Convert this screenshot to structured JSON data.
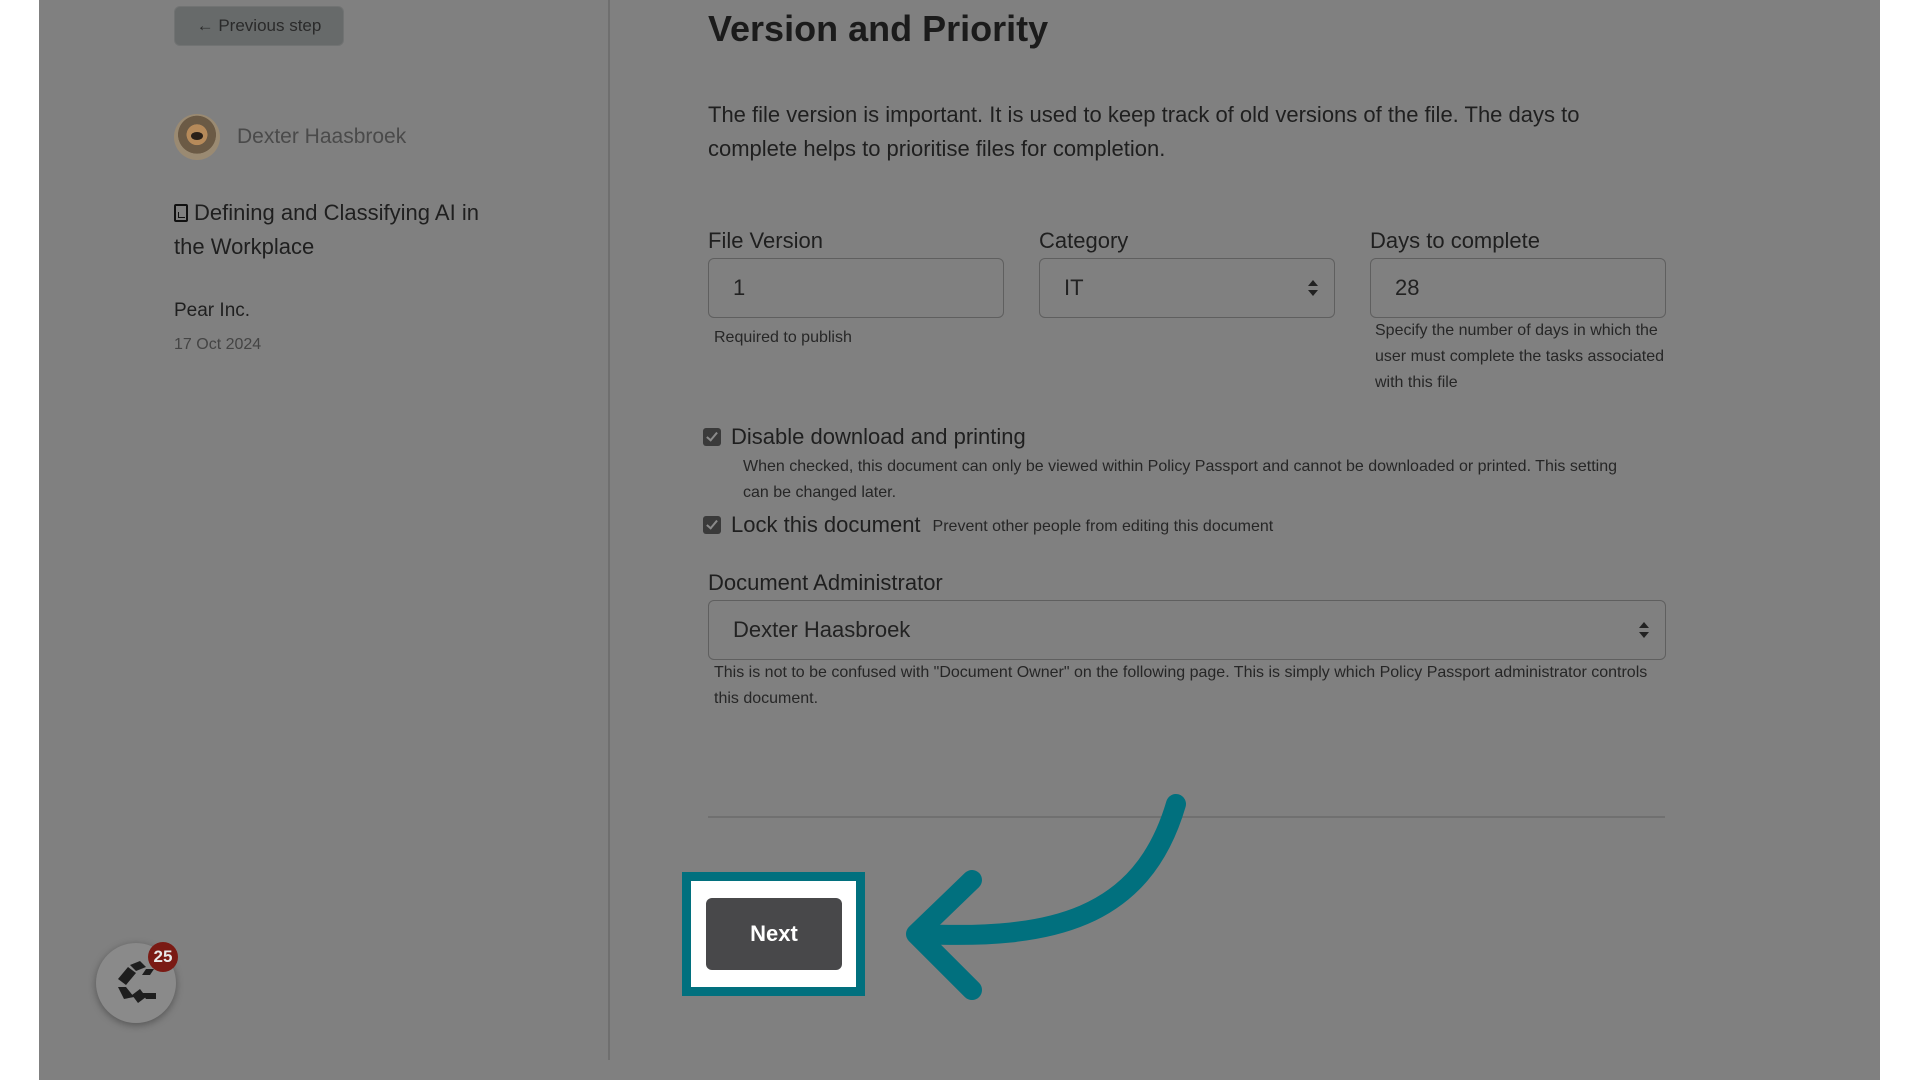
{
  "sidebar": {
    "previous_step_label": "← Previous step",
    "author_name": "Dexter Haasbroek",
    "document_title": "Defining and Classifying AI in the Workplace",
    "document_icon": "pdf-file-icon",
    "organization": "Pear Inc.",
    "date": "17 Oct 2024"
  },
  "launcher": {
    "icon": "app-logo-icon",
    "badge_count": "25"
  },
  "main": {
    "title": "Version and Priority",
    "intro": "The file version is important. It is used to keep track of old versions of the file. The days to complete helps to prioritise files for completion.",
    "file_version": {
      "label": "File Version",
      "value": "1",
      "help": "Required to publish"
    },
    "category": {
      "label": "Category",
      "selected": "IT"
    },
    "days_to_complete": {
      "label": "Days to complete",
      "value": "28",
      "help": "Specify the number of days in which the user must complete the tasks associated with this file"
    },
    "disable_download": {
      "label": "Disable download and printing",
      "checked": true,
      "help": "When checked, this document can only be viewed within Policy Passport and cannot be downloaded or printed. This setting can be changed later."
    },
    "lock_document": {
      "label": "Lock this document",
      "checked": true,
      "help": "Prevent other people from editing this document"
    },
    "document_administrator": {
      "label": "Document Administrator",
      "selected": "Dexter Haasbroek",
      "help": "This is not to be confused with \"Document Owner\" on the following page. This is simply which Policy Passport administrator controls this document."
    },
    "next_label": "Next"
  },
  "annotation": {
    "highlight_color": "#01707e",
    "arrow_icon": "curved-arrow-left-icon"
  }
}
